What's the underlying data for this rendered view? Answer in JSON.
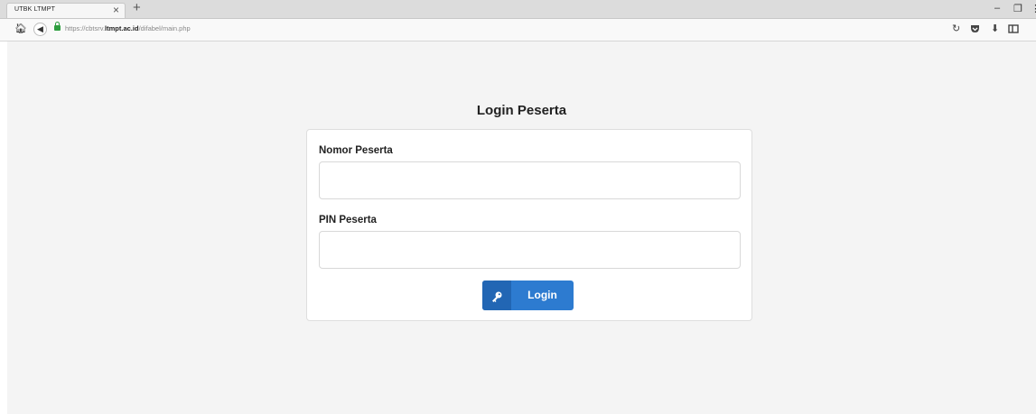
{
  "browser": {
    "tab_title": "UTBK LTMPT",
    "tab_close": "×",
    "new_tab": "+",
    "url_prefix": "https://cbtsrv.",
    "url_domain": "ltmpt.ac.id",
    "url_path": "/difabel/main.php",
    "window": {
      "minimize": "–",
      "restore": "❐",
      "more": "⋮"
    },
    "toolbar_icons": [
      "home-icon",
      "back-icon",
      "lock-icon",
      "reload-icon",
      "pocket-icon",
      "download-icon",
      "sidebar-icon"
    ]
  },
  "login": {
    "title": "Login Peserta",
    "nomor_label": "Nomor Peserta",
    "nomor_value": "",
    "pin_label": "PIN Peserta",
    "pin_value": "",
    "button_label": "Login",
    "button_icon": "key-icon"
  },
  "colors": {
    "button": "#2d7bd0",
    "button_icon_bg": "#2266b4",
    "page_bg": "#f4f4f4",
    "lock": "#2e9e3f"
  }
}
